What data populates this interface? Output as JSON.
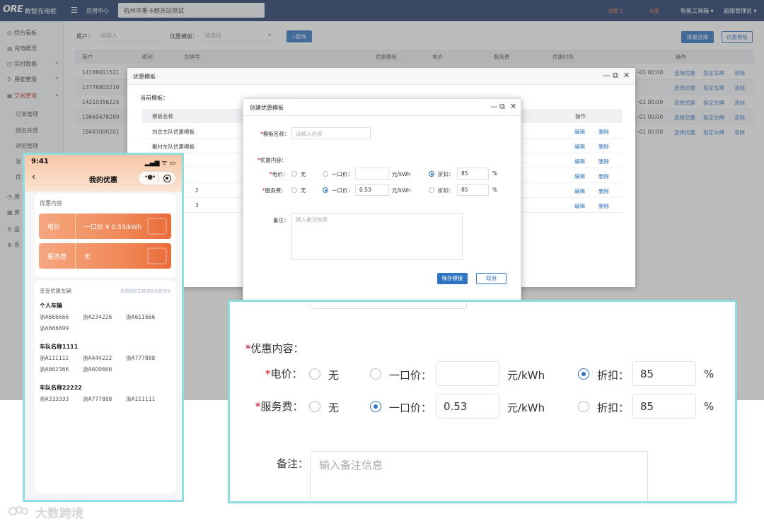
{
  "topbar": {
    "logo": "ORE",
    "app_name": "数智充电桩",
    "app_center": "应用中心",
    "tenant": "杭州市重卡超充站测试",
    "alert_1": "预警 1",
    "alert_2": "告警",
    "tools": "智能工具箱 ▾",
    "user": "超级管理员 ▾"
  },
  "sidebar": {
    "items": [
      {
        "label": "综合看板",
        "icon": "dashboard-icon"
      },
      {
        "label": "充电概况",
        "icon": "overview-icon"
      },
      {
        "label": "实时数据",
        "icon": "realtime-icon"
      },
      {
        "label": "用能管理",
        "icon": "energy-icon"
      },
      {
        "label": "交易管理",
        "icon": "trade-icon"
      }
    ],
    "sub_items": [
      "订单管理",
      "钱包充值",
      "退款管理",
      "发",
      "优"
    ],
    "more_items": [
      "用",
      "资",
      "运",
      "系"
    ]
  },
  "filters": {
    "user_label": "用户：",
    "user_placeholder": "请输入",
    "template_label": "优惠模板：",
    "template_placeholder": "请选择",
    "query_button": "查询",
    "batch_button": "批量选择",
    "template_button": "优惠模板"
  },
  "grid": {
    "headers": [
      "用户",
      "昵称",
      "车牌号",
      "优惠模板",
      "电价",
      "服务费",
      "优惠时段",
      "操作"
    ],
    "rows": [
      {
        "user": "14188011521",
        "time": "-01 00:00"
      },
      {
        "user": "13776003210",
        "time": ""
      },
      {
        "user": "14210356225",
        "time": "-01 00:00"
      },
      {
        "user": "19660478289",
        "time": "-01 00:00"
      },
      {
        "user": "18483080201",
        "time": "-01 00:00"
      }
    ],
    "row_ops": [
      "选择优惠",
      "指定车牌",
      "清除"
    ]
  },
  "modal_templates": {
    "title": "优惠模板",
    "current_label": "当前模板：",
    "headers": [
      "模板名称",
      "操作"
    ],
    "rows": [
      "刘总车队优惠模板",
      "戴村车队优惠模板",
      "",
      "",
      "2",
      "3"
    ],
    "ops": [
      "编辑",
      "删除"
    ]
  },
  "modal_create": {
    "title": "创建优惠模板",
    "name_label": "模板名称：",
    "name_placeholder": "请输入名称",
    "content_label": "优惠内容：",
    "price_label": "电价：",
    "service_label": "服务费：",
    "opt_none": "无",
    "opt_fixed": "一口价：",
    "unit": "元/kWh",
    "opt_discount": "折扣：",
    "price_fixed_value": "",
    "price_discount_value": "85",
    "service_fixed_value": "0.53",
    "service_discount_value": "85",
    "percent": "%",
    "remark_label": "备注：",
    "remark_placeholder": "输入备注信息",
    "save_button": "保存模板",
    "cancel_button": "取消"
  },
  "phone": {
    "time": "9:41",
    "status": "▂▄▆ ᯤ ▭",
    "title": "我的优惠",
    "section_discount": "优惠内容",
    "coupons": [
      {
        "key": "电价",
        "value": "一口价 ¥ 0.53/kWh"
      },
      {
        "key": "服务费",
        "value": "无"
      }
    ],
    "section_vehicles": "享受优惠车辆",
    "hint": "若需删除车辆请联系管理员",
    "groups": [
      {
        "name": "个人车辆",
        "plates": [
          "浙A666666",
          "浙A234226",
          "浙A611666",
          "浙A666699"
        ]
      },
      {
        "name": "车队名称1111",
        "plates": [
          "浙A111111",
          "浙A444222",
          "浙A777888",
          "浙A662366",
          "浙A600666"
        ]
      },
      {
        "name": "车队名称22222",
        "plates": [
          "浙A333333",
          "浙A777888",
          "浙A111111"
        ]
      }
    ]
  },
  "watermark": "大数跨境",
  "colors": {
    "primary": "#2f74c0",
    "header": "#1f3a66",
    "coupon": "#ea6c3a",
    "highlight_border": "#8fdde2"
  }
}
